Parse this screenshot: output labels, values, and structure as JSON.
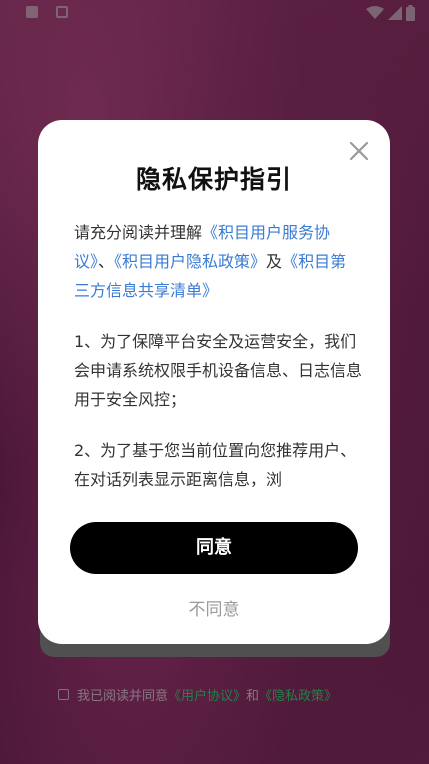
{
  "dialog": {
    "title": "隐私保护指引",
    "intro_prefix": "请充分阅读并理解",
    "link_service": "《积目用户服务协议》",
    "sep1": "、",
    "link_privacy": "《积目用户隐私政策》",
    "and_text": "及",
    "link_third_party": "《积目第三方信息共享清单》",
    "para1": "1、为了保障平台安全及运营安全，我们会申请系统权限手机设备信息、日志信息用于安全风控；",
    "para2": "2、为了基于您当前位置向您推荐用户、在对话列表显示距离信息，浏",
    "agree_label": "同意",
    "disagree_label": "不同意"
  },
  "background": {
    "consent_prefix": "我已阅读并同意",
    "consent_link1": "《用户协议》",
    "consent_and": "和",
    "consent_link2": "《隐私政策》"
  },
  "colors": {
    "link": "#3a7bd5",
    "consent_link": "#3fdc7c",
    "agree_button": "#000000"
  }
}
